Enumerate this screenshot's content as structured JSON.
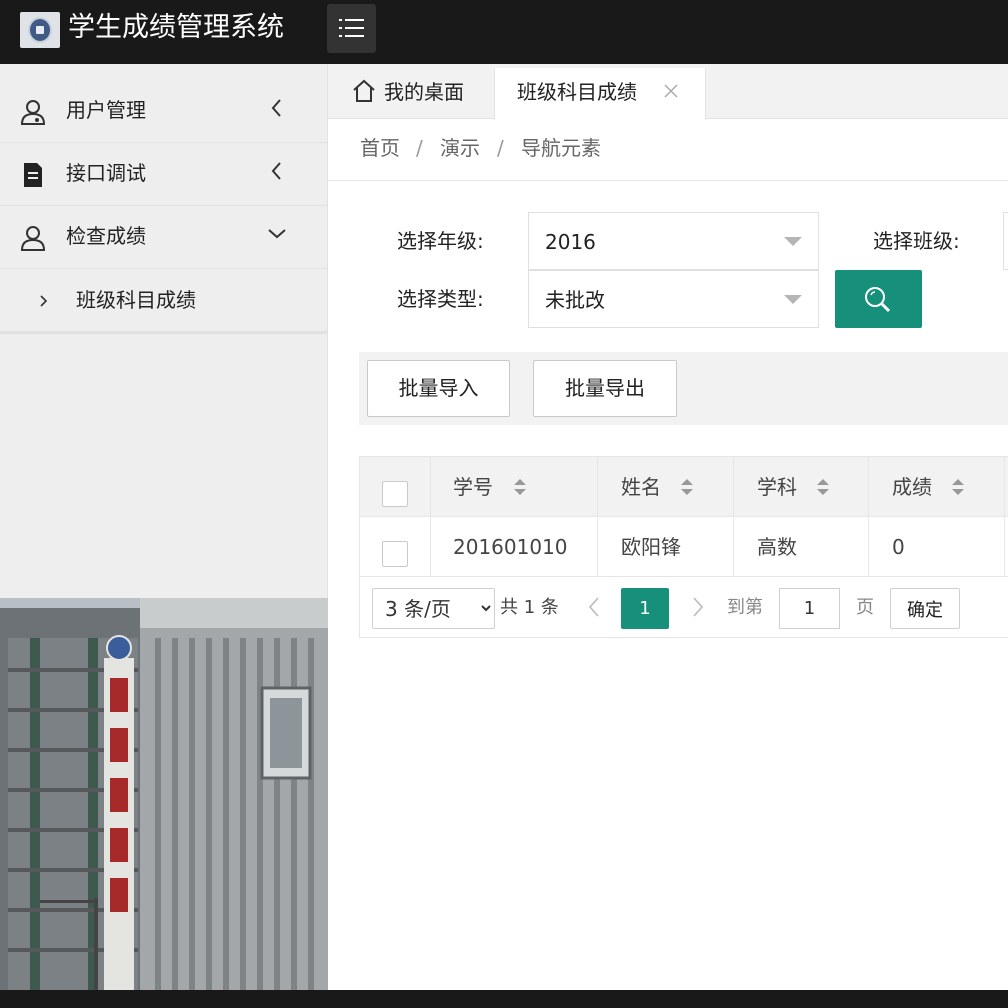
{
  "header": {
    "app_title": "学生成绩管理系统",
    "logo_icon": "school-emblem-icon",
    "menu_icon": "hamburger-icon",
    "bg_color": "#191919"
  },
  "sidebar": {
    "items": [
      {
        "label": "用户管理",
        "icon": "user-icon",
        "state": "collapsed"
      },
      {
        "label": "接口调试",
        "icon": "document-icon",
        "state": "collapsed"
      },
      {
        "label": "检查成绩",
        "icon": "person-icon",
        "state": "expanded"
      }
    ],
    "sub_items": [
      {
        "label": "班级科目成绩"
      }
    ]
  },
  "tabs": {
    "home_label": "我的桌面",
    "active_label": "班级科目成绩"
  },
  "breadcrumb": [
    "首页",
    "演示",
    "导航元素"
  ],
  "filters": {
    "grade_label": "选择年级:",
    "grade_value": "2016",
    "class_label": "选择班级:",
    "type_label": "选择类型:",
    "type_value": "未批改",
    "search_icon": "search-icon"
  },
  "toolbar": {
    "import_label": "批量导入",
    "export_label": "批量导出"
  },
  "table": {
    "columns": [
      "学号",
      "姓名",
      "学科",
      "成绩"
    ],
    "rows": [
      [
        "201601010",
        "欧阳锋",
        "高数",
        "0"
      ]
    ]
  },
  "pager": {
    "page_size": "3 条/页",
    "page_size_options": [
      "3 条/页"
    ],
    "total": "共 1 条",
    "current_page": "1",
    "goto_label": "到第",
    "goto_value": "1",
    "page_unit": "页",
    "confirm_label": "确定"
  },
  "theme": {
    "accent": "#16907a",
    "sidebar_bg": "#eeeeee"
  }
}
